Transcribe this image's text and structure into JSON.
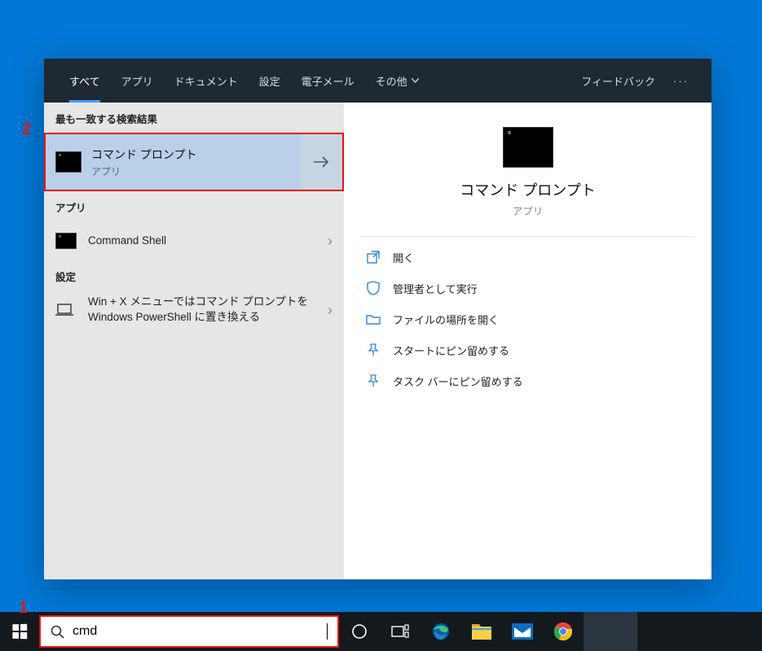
{
  "tabs": {
    "all": "すべて",
    "apps": "アプリ",
    "documents": "ドキュメント",
    "settings": "設定",
    "email": "電子メール",
    "more": "その他",
    "feedback": "フィードバック"
  },
  "left": {
    "best_match_header": "最も一致する検索結果",
    "best_match": {
      "title": "コマンド プロンプト",
      "subtitle": "アプリ"
    },
    "apps_header": "アプリ",
    "command_shell": "Command Shell",
    "settings_header": "設定",
    "winx_setting": "Win + X メニューではコマンド プロンプトを Windows PowerShell に置き換える"
  },
  "detail": {
    "title": "コマンド プロンプト",
    "subtitle": "アプリ",
    "actions": {
      "open": "開く",
      "run_admin": "管理者として実行",
      "open_location": "ファイルの場所を開く",
      "pin_start": "スタートにピン留めする",
      "pin_taskbar": "タスク バーにピン留めする"
    }
  },
  "search": {
    "value": "cmd"
  },
  "callouts": {
    "one": "1",
    "two": "2"
  }
}
